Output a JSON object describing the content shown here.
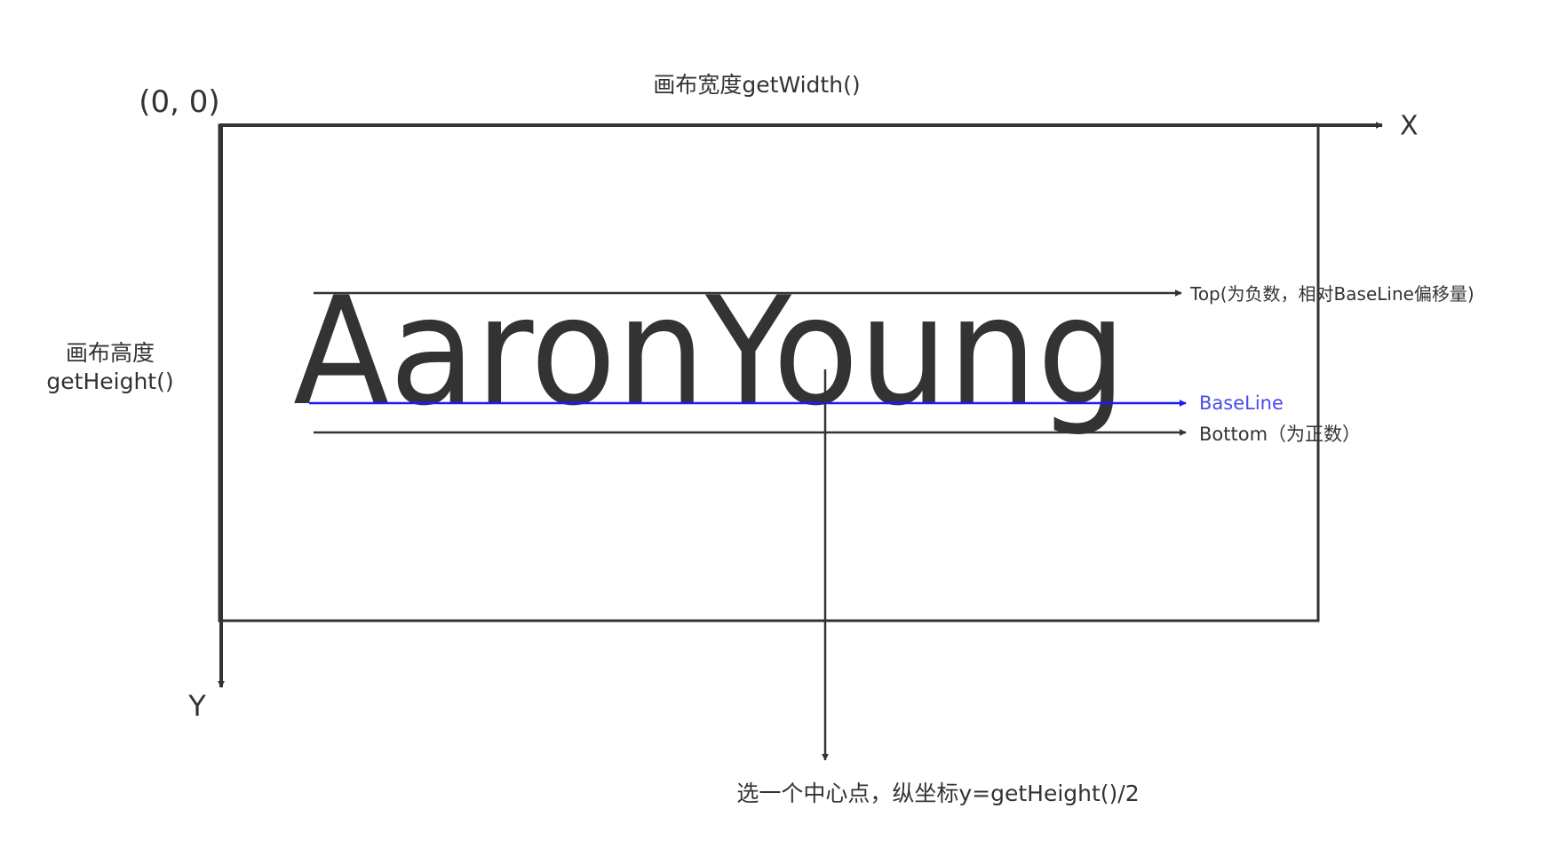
{
  "labels": {
    "origin": "(0, 0)",
    "canvas_width": "画布宽度getWidth()",
    "x_axis": "X",
    "y_axis": "Y",
    "canvas_height_line1": "画布高度",
    "canvas_height_line2": "getHeight()",
    "sample_text": "AaronYoung",
    "top_label": "Top(为负数，相对BaseLine偏移量)",
    "baseline_label": "BaseLine",
    "bottom_label": "Bottom（为正数）",
    "center_label": "选一个中心点，纵坐标y=getHeight()/2"
  },
  "colors": {
    "line": "#333333",
    "baseline": "#1a1aff",
    "baseline_text": "#4a4aee"
  }
}
